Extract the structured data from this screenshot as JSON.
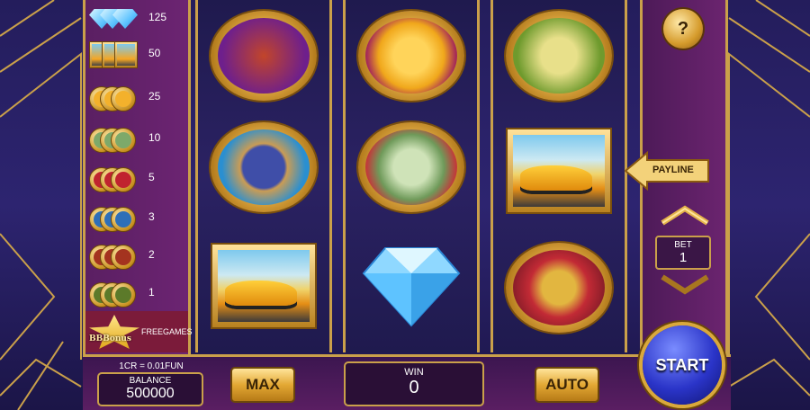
{
  "colors": {
    "gold_frame": "#caa04a",
    "paytable_bg": "#6c2472",
    "reel_bg": "#2b2263",
    "start_blue": "#2a34c8"
  },
  "paytable": {
    "rows": [
      {
        "symbol": "diamond-icon",
        "value": "125"
      },
      {
        "symbol": "car-icon",
        "value": "50"
      },
      {
        "symbol": "gold-bars-icon",
        "value": "25"
      },
      {
        "symbol": "money-stack-icon",
        "value": "10"
      },
      {
        "symbol": "ring-icon",
        "value": "5"
      },
      {
        "symbol": "watch-icon",
        "value": "3"
      },
      {
        "symbol": "cognac-icon",
        "value": "2"
      },
      {
        "symbol": "champagne-icon",
        "value": "1"
      }
    ],
    "bonus": {
      "symbol_text": "BBBonus",
      "value": "FREEGAMES"
    }
  },
  "reels": [
    [
      "cognac-icon",
      "watch-icon",
      "car-icon"
    ],
    [
      "gold-bars-icon",
      "money-stack-icon",
      "diamond-icon"
    ],
    [
      "champagne-icon",
      "car-icon",
      "ring-icon"
    ]
  ],
  "controls": {
    "help_label": "?",
    "payline_label": "PAYLINE",
    "bet_label": "BET",
    "bet_value": "1",
    "rate_text": "1CR = 0.01FUN",
    "balance_label": "BALANCE",
    "balance_value": "500000",
    "max_label": "MAX",
    "win_label": "WIN",
    "win_value": "0",
    "auto_label": "AUTO",
    "start_label": "START"
  }
}
